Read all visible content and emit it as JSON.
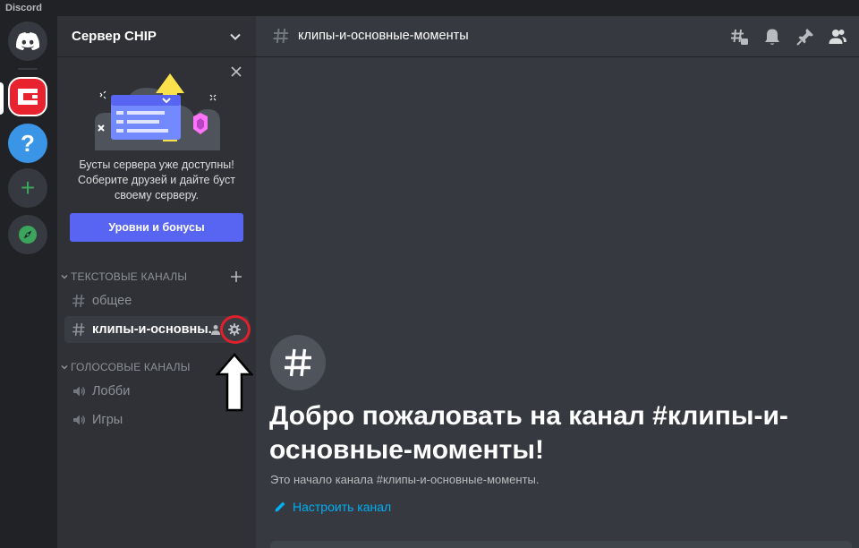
{
  "window": {
    "app_name": "Discord"
  },
  "guilds": [
    {
      "name": "home",
      "icon": "discord-logo-icon"
    },
    {
      "name": "chip-server",
      "icon": "chip-logo-icon",
      "active": true
    },
    {
      "name": "help",
      "icon": "question-icon",
      "glyph": "?"
    },
    {
      "name": "add-server",
      "icon": "plus-icon",
      "glyph": "+"
    },
    {
      "name": "explore",
      "icon": "compass-icon"
    }
  ],
  "sidebar": {
    "server_name": "Сервер CHIP",
    "boost": {
      "text": "Бусты сервера уже доступны! Соберите друзей и дайте буст своему серверу.",
      "button": "Уровни и бонусы"
    },
    "categories": [
      {
        "label": "ТЕКСТОВЫЕ КАНАЛЫ",
        "channels": [
          {
            "name": "общее",
            "type": "text"
          },
          {
            "name": "клипы-и-основны...",
            "type": "text",
            "selected": true
          }
        ]
      },
      {
        "label": "ГОЛОСОВЫЕ КАНАЛЫ",
        "channels": [
          {
            "name": "Лобби",
            "type": "voice"
          },
          {
            "name": "Игры",
            "type": "voice"
          }
        ]
      }
    ]
  },
  "main": {
    "channel_title": "клипы-и-основные-моменты",
    "header_icons": [
      "threads-icon",
      "bell-icon",
      "pin-icon",
      "members-icon"
    ],
    "welcome_title": "Добро пожаловать на канал #клипы-и-основные-моменты!",
    "welcome_sub": "Это начало канала #клипы-и-основные-моменты.",
    "setup_link": "Настроить канал"
  },
  "colors": {
    "accent": "#5865f2",
    "link": "#00aff4",
    "server_red": "#e8222e",
    "annotation_red": "#e0202a"
  }
}
